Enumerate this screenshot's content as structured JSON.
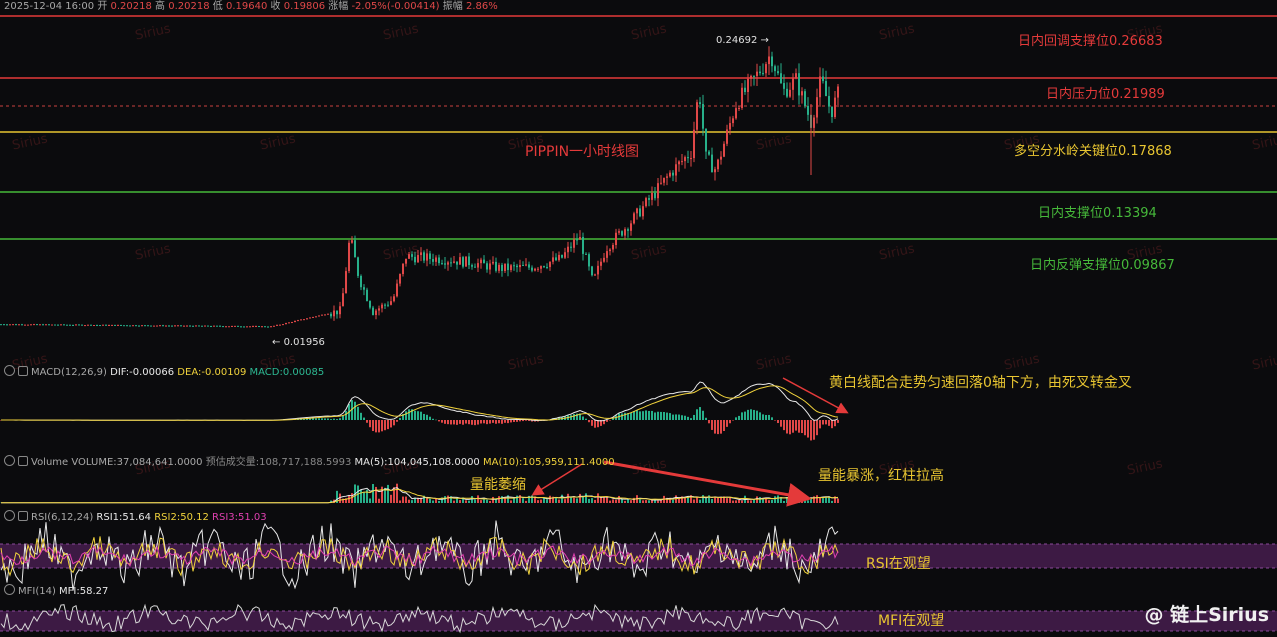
{
  "header": {
    "datetime": "2025-12-04 16:00",
    "open_label": "开",
    "open": "0.20218",
    "high_label": "高",
    "high": "0.20218",
    "low_label": "低",
    "low": "0.19640",
    "close_label": "收",
    "close": "0.19806",
    "change_label": "涨幅",
    "change": "-2.05%(-0.00414)",
    "amplitude_label": "振幅",
    "amplitude": "2.86%"
  },
  "chart_title": "PIPPIN一小时线图",
  "price_markers": {
    "high": "0.24692",
    "low": "0.01956"
  },
  "levels": [
    {
      "label": "日内回调支撑位0.26683",
      "value": 0.26683,
      "color": "#e43a3a"
    },
    {
      "label": "日内压力位0.21989",
      "value": 0.21989,
      "color": "#e43a3a"
    },
    {
      "label": "多空分水岭关键位0.17868",
      "value": 0.17868,
      "color": "#e8c531"
    },
    {
      "label": "日内支撑位0.13394",
      "value": 0.13394,
      "color": "#46b93a"
    },
    {
      "label": "日内反弹支撑位0.09867",
      "value": 0.09867,
      "color": "#46b93a"
    }
  ],
  "macd": {
    "name": "MACD(12,26,9)",
    "dif_label": "DIF:",
    "dif": "-0.00066",
    "dea_label": "DEA:",
    "dea": "-0.00109",
    "macd_label": "MACD:",
    "macd": "0.00085",
    "note": "黄白线配合走势匀速回落0轴下方，由死叉转金叉"
  },
  "volume": {
    "name": "Volume",
    "volume_label": "VOLUME:",
    "volume": "37,084,641.0000",
    "est_label": "预估成交量:",
    "est": "108,717,188.5993",
    "ma5_label": "MA(5):",
    "ma5": "104,045,108.0000",
    "ma10_label": "MA(10):",
    "ma10": "105,959,111.4000",
    "note_left": "量能萎缩",
    "note_right": "量能暴涨，红柱拉高"
  },
  "rsi": {
    "name": "RSI(6,12,24)",
    "rsi1_label": "RSI1:",
    "rsi1": "51.64",
    "rsi2_label": "RSI2:",
    "rsi2": "50.12",
    "rsi3_label": "RSI3:",
    "rsi3": "51.03",
    "note": "RSI在观望"
  },
  "mfi": {
    "name": "MFI(14)",
    "mfi_label": "MFI:",
    "mfi": "58.27",
    "note": "MFI在观望"
  },
  "watermark": "Sirius",
  "logo": "@ 链上Sirius",
  "colors": {
    "up": "#e04848",
    "down": "#27b08a",
    "bg": "#0b0b0d"
  },
  "chart_data": {
    "type": "candlestick",
    "price_range": [
      0.0,
      0.28
    ],
    "levels": [
      0.26683,
      0.21989,
      0.17868,
      0.13394,
      0.09867
    ],
    "anchors": [
      [
        0,
        0.0215
      ],
      [
        270,
        0.0196
      ],
      [
        278,
        0.021
      ],
      [
        340,
        0.033
      ],
      [
        349,
        0.095
      ],
      [
        358,
        0.06
      ],
      [
        372,
        0.032
      ],
      [
        392,
        0.042
      ],
      [
        405,
        0.078
      ],
      [
        440,
        0.076
      ],
      [
        470,
        0.073
      ],
      [
        500,
        0.068
      ],
      [
        530,
        0.069
      ],
      [
        560,
        0.076
      ],
      [
        578,
        0.095
      ],
      [
        592,
        0.056
      ],
      [
        605,
        0.085
      ],
      [
        630,
        0.107
      ],
      [
        655,
        0.132
      ],
      [
        670,
        0.148
      ],
      [
        690,
        0.165
      ],
      [
        698,
        0.218
      ],
      [
        705,
        0.16
      ],
      [
        715,
        0.15
      ],
      [
        735,
        0.205
      ],
      [
        755,
        0.228
      ],
      [
        770,
        0.2469
      ],
      [
        782,
        0.215
      ],
      [
        795,
        0.225
      ],
      [
        810,
        0.19
      ],
      [
        820,
        0.225
      ],
      [
        830,
        0.198
      ],
      [
        838,
        0.215
      ]
    ]
  }
}
